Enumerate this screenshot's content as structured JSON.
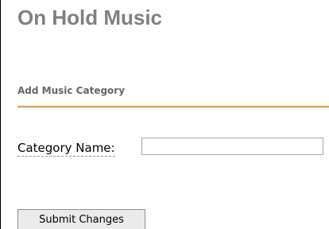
{
  "page": {
    "title": "On Hold Music"
  },
  "section": {
    "heading": "Add Music Category"
  },
  "form": {
    "category_name_label": "Category Name:",
    "category_name_value": "",
    "submit_label": "Submit Changes"
  },
  "colors": {
    "title": "#808080",
    "heading": "#666666",
    "accent_rule": "#e2a24d"
  }
}
